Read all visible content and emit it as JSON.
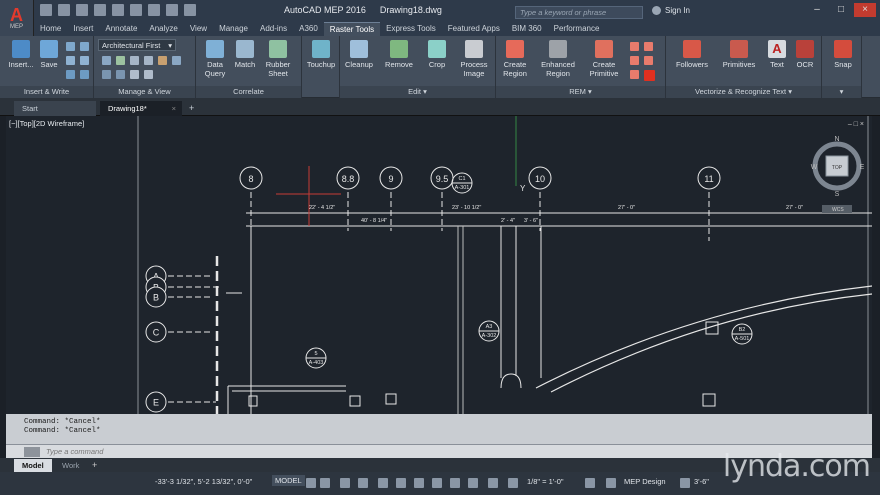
{
  "app": {
    "logo_letter": "A",
    "logo_sub": "MEP",
    "name": "AutoCAD MEP 2016",
    "file": "Drawing18.dwg"
  },
  "search": {
    "placeholder": "Type a keyword or phrase"
  },
  "account": {
    "signin": "Sign In"
  },
  "ribbon_tabs": [
    "Home",
    "Insert",
    "Annotate",
    "Analyze",
    "View",
    "Manage",
    "Add-ins",
    "A360",
    "Raster Tools",
    "Express Tools",
    "Featured Apps",
    "BIM 360",
    "Performance"
  ],
  "active_tab": "Raster Tools",
  "ribbon": {
    "insert_write": {
      "label": "Insert & Write",
      "tools": [
        "Insert...",
        "Save"
      ]
    },
    "manage_view": {
      "label": "Manage & View",
      "dropdown": "Architectural First"
    },
    "correlate": {
      "label": "Correlate",
      "tools": [
        "Data Query",
        "Match",
        "Rubber Sheet"
      ]
    },
    "touchup": {
      "label": "Touchup"
    },
    "edit": {
      "label": "Edit",
      "tools": [
        "Cleanup",
        "Remove",
        "Crop",
        "Process Image"
      ]
    },
    "rem": {
      "label": "REM",
      "tools": [
        "Create Region",
        "Enhanced Region",
        "Create Primitive"
      ]
    },
    "vectorize": {
      "label": "Vectorize & Recognize Text",
      "tools": [
        "Followers",
        "Primitives",
        "Text",
        "OCR"
      ]
    },
    "snap": {
      "label": "Snap"
    }
  },
  "doc_tabs": {
    "start": "Start",
    "drawing": "Drawing18*",
    "add": "+"
  },
  "viewport": {
    "label": "[−][Top][2D Wireframe]",
    "controls": "– □ ×"
  },
  "viewcube": {
    "n": "N",
    "s": "S",
    "e": "E",
    "w": "W",
    "top": "TOP",
    "wcs": "WCS"
  },
  "drawing": {
    "grid_columns": [
      "8",
      "8.8",
      "9",
      "9.5",
      "10",
      "11"
    ],
    "grid_rows": [
      "A",
      "B",
      "B",
      "C",
      "E"
    ],
    "dims": [
      "22' - 4 1/2\"",
      "40' - 8 1/4\"",
      "23' - 10 1/2\"",
      "2' - 4\"",
      "3' - 6\"",
      "27' - 0\"",
      "27' - 0\""
    ],
    "sections": [
      {
        "id": "C1",
        "sheet": "A-301"
      },
      {
        "id": "5",
        "sheet": "A-403"
      },
      {
        "id": "A3",
        "sheet": "A-302"
      },
      {
        "id": "B2",
        "sheet": "A-501"
      }
    ],
    "axis_y": "Y"
  },
  "command": {
    "history": [
      "Command: *Cancel*",
      "Command: *Cancel*"
    ],
    "placeholder": "Type a command"
  },
  "layout_tabs": {
    "model": "Model",
    "work": "Work",
    "add": "+"
  },
  "status": {
    "coords": "-33'-3 1/32\", 5'-2 13/32\", 0'-0\"",
    "space": "MODEL",
    "scale": "1/8\" = 1'-0\"",
    "workspace": "MEP Design",
    "elevation": "3'-6\""
  },
  "watermark": "lynda.com",
  "colors": {
    "accent_red": "#e23a2d",
    "background": "#1e242c"
  }
}
